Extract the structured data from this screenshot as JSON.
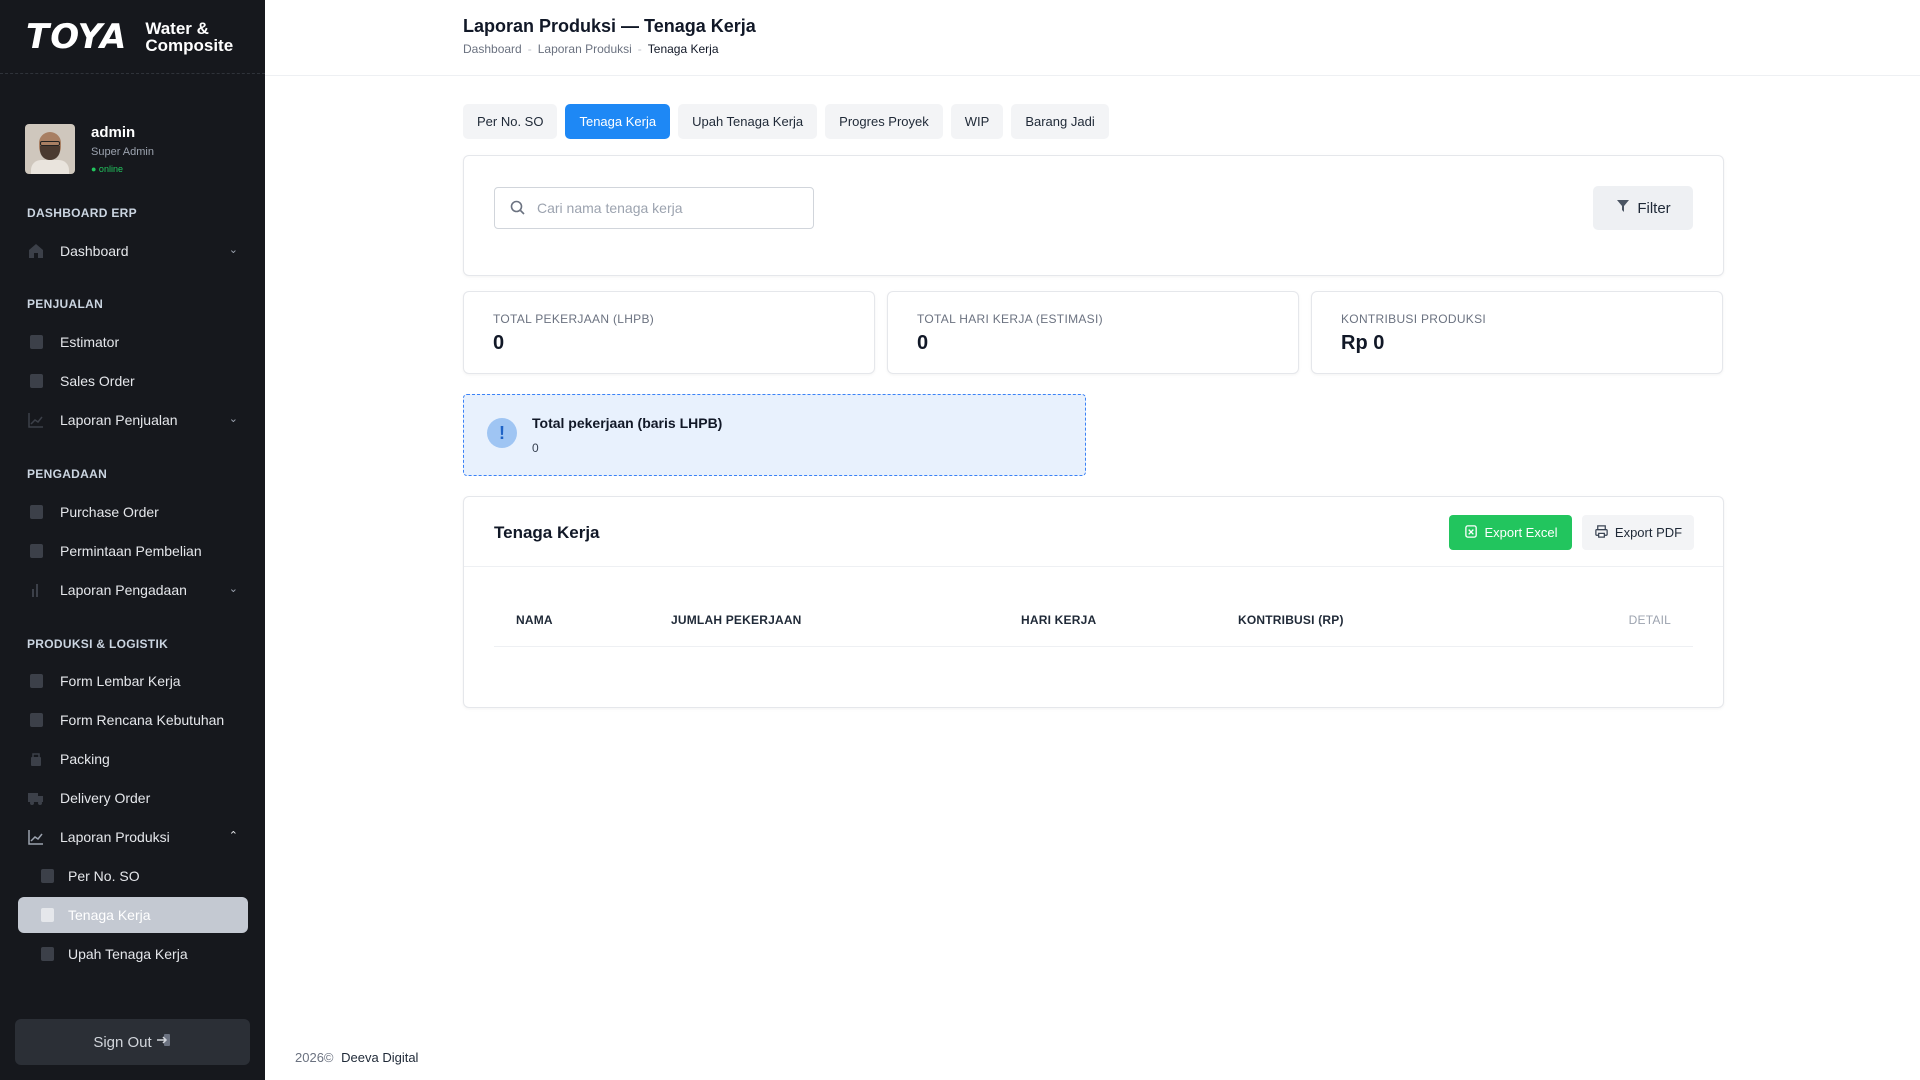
{
  "brand": {
    "logo": "TOYA",
    "sub_line1": "Water &",
    "sub_line2": "Composite"
  },
  "user": {
    "name": "admin",
    "role": "Super Admin",
    "status": "● online"
  },
  "sidebar": {
    "sections": [
      {
        "title": "DASHBOARD ERP"
      },
      {
        "title": "PENJUALAN"
      },
      {
        "title": "PENGADAAN"
      },
      {
        "title": "PRODUKSI & LOGISTIK"
      }
    ],
    "items": [
      {
        "label": "Dashboard"
      },
      {
        "label": "Estimator"
      },
      {
        "label": "Sales Order"
      },
      {
        "label": "Laporan Penjualan"
      },
      {
        "label": "Purchase Order"
      },
      {
        "label": "Permintaan Pembelian"
      },
      {
        "label": "Laporan Pengadaan"
      },
      {
        "label": "Form Lembar Kerja"
      },
      {
        "label": "Form Rencana Kebutuhan"
      },
      {
        "label": "Packing"
      },
      {
        "label": "Delivery Order"
      },
      {
        "label": "Laporan Produksi"
      },
      {
        "label": "Per No. SO"
      },
      {
        "label": "Tenaga Kerja"
      },
      {
        "label": "Upah Tenaga Kerja"
      }
    ],
    "signout": "Sign Out"
  },
  "header": {
    "title": "Laporan Produksi — Tenaga Kerja",
    "breadcrumb": [
      "Dashboard",
      "Laporan Produksi",
      "Tenaga Kerja"
    ]
  },
  "tabs": [
    {
      "label": "Per No. SO"
    },
    {
      "label": "Tenaga Kerja"
    },
    {
      "label": "Upah Tenaga Kerja"
    },
    {
      "label": "Progres Proyek"
    },
    {
      "label": "WIP"
    },
    {
      "label": "Barang Jadi"
    }
  ],
  "search": {
    "placeholder": "Cari nama tenaga kerja",
    "value": ""
  },
  "filter_label": "Filter",
  "stats": [
    {
      "caption": "TOTAL PEKERJAAN (LHPB)",
      "value": "0"
    },
    {
      "caption": "TOTAL HARI KERJA (ESTIMASI)",
      "value": "0"
    },
    {
      "caption": "KONTRIBUSI PRODUKSI",
      "value": "Rp 0"
    }
  ],
  "info": {
    "icon": "!",
    "title": "Total pekerjaan (baris LHPB)",
    "value": "0"
  },
  "table": {
    "title": "Tenaga Kerja",
    "export_excel": "Export Excel",
    "export_pdf": "Export PDF",
    "columns": [
      "NAMA",
      "JUMLAH PEKERJAAN",
      "HARI KERJA",
      "KONTRIBUSI (RP)",
      "DETAIL"
    ],
    "rows": []
  },
  "footer": {
    "year": "2026©",
    "company": "Deeva Digital"
  },
  "colors": {
    "primary": "#1e88f5",
    "success": "#22c55e",
    "sidebar_bg": "#16181d",
    "info_bg": "#e8f1fd"
  }
}
